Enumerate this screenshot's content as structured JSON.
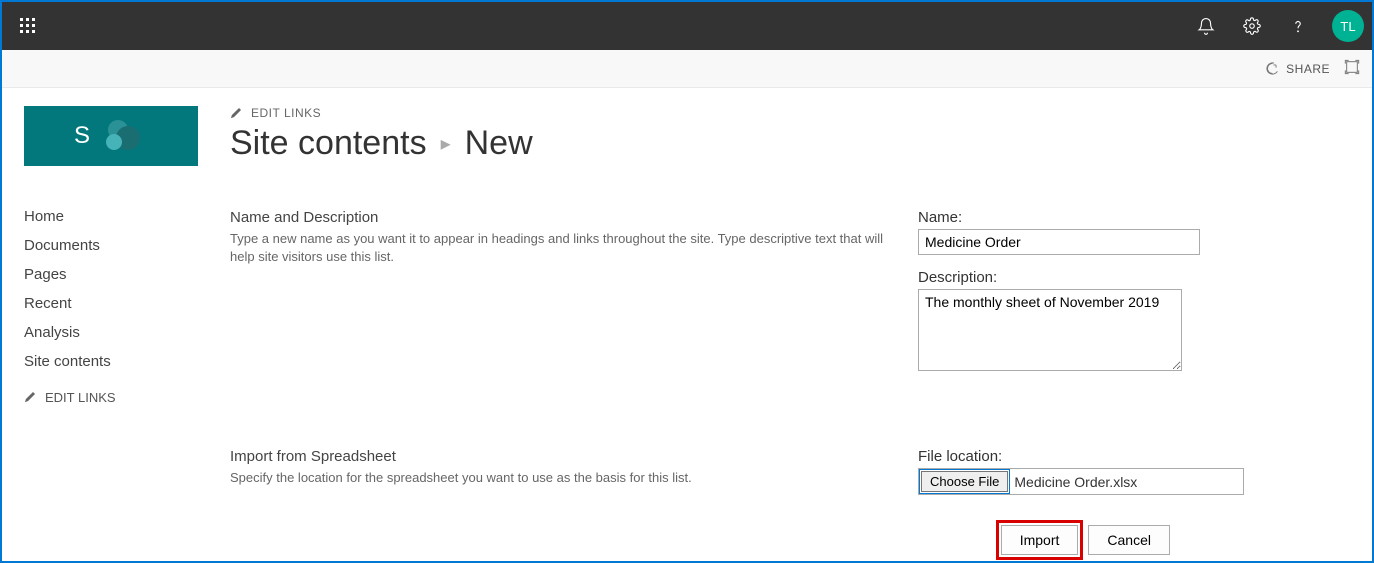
{
  "topbar": {
    "avatar_initials": "TL"
  },
  "sharebar": {
    "share_label": "SHARE"
  },
  "sidebar": {
    "nav": [
      "Home",
      "Documents",
      "Pages",
      "Recent",
      "Analysis",
      "Site contents"
    ],
    "edit_links": "EDIT LINKS"
  },
  "header": {
    "edit_links": "EDIT LINKS",
    "title_main": "Site contents",
    "title_sub": "New"
  },
  "section1": {
    "title": "Name and Description",
    "desc": "Type a new name as you want it to appear in headings and links throughout the site. Type descriptive text that will help site visitors use this list.",
    "name_label": "Name:",
    "name_value": "Medicine Order",
    "desc_label": "Description:",
    "desc_value": "The monthly sheet of November 2019"
  },
  "section2": {
    "title": "Import from Spreadsheet",
    "desc": "Specify the location for the spreadsheet you want to use as the basis for this list.",
    "file_label": "File location:",
    "choose_label": "Choose File",
    "file_name": "Medicine Order.xlsx"
  },
  "buttons": {
    "import": "Import",
    "cancel": "Cancel"
  }
}
